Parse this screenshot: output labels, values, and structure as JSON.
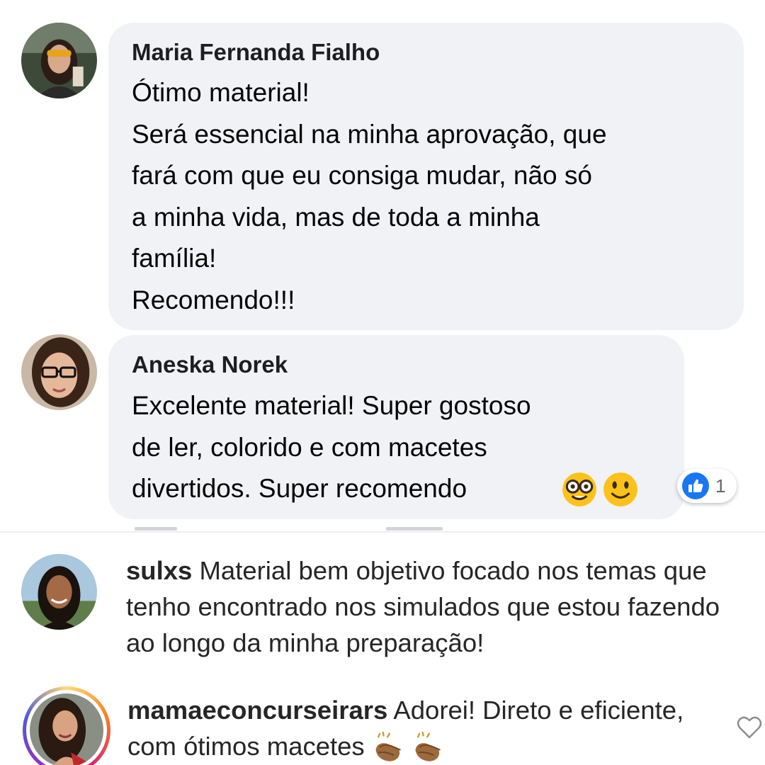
{
  "facebook": {
    "comments": [
      {
        "author": "Maria Fernanda Fialho",
        "text": "Ótimo material!\nSerá essencial na minha aprovação, que\nfará com que eu consiga mudar, não só\na minha vida, mas de toda a minha\nfamília!\nRecomendo!!!"
      },
      {
        "author": "Aneska Norek",
        "text": "Excelente material! Super gostoso\nde ler, colorido e com macetes\ndivertidos. Super recomendo",
        "emojis": [
          "nerd-face-emoji",
          "smiling-face-emoji"
        ],
        "reaction": {
          "icon": "like-icon",
          "count": "1"
        }
      }
    ],
    "colors": {
      "bubble": "#f0f2f5",
      "like_blue": "#1877f2"
    }
  },
  "instagram": {
    "comments": [
      {
        "username": "sulxs",
        "text": "Material bem objetivo focado nos temas que tenho encontrado nos simulados que estou fazendo ao longo da minha preparação!"
      },
      {
        "username": "mamaeconcurseirars",
        "text": "Adorei! Direto e eficiente, com ótimos macetes",
        "emojis": [
          "clapping-hands-emoji",
          "clapping-hands-emoji"
        ],
        "like_icon": "heart-icon"
      }
    ]
  }
}
